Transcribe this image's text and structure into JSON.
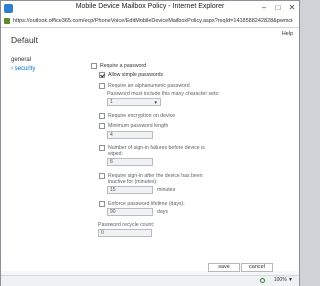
{
  "window": {
    "title": "Mobile Device Mailbox Policy - Internet Explorer",
    "url": "https://outlook.office365.com/ecp/PhoneVoice/EditMobileDeviceMailboxPolicy.aspx?reqId=1418588242828&pwmcid=3&Retu"
  },
  "page": {
    "title": "Default",
    "help": "Help"
  },
  "nav": {
    "items": [
      {
        "label": "general",
        "active": false
      },
      {
        "label": "security",
        "active": true
      }
    ]
  },
  "form": {
    "require_password": {
      "label": "Require a password",
      "checked": false
    },
    "allow_simple": {
      "label": "Allow simple passwords",
      "checked": true
    },
    "require_alnum": {
      "label": "Require an alphanumeric password",
      "checked": false
    },
    "char_sets_label": "Password must include this many character sets:",
    "char_sets_value": "1",
    "require_encryption": {
      "label": "Require encryption on device",
      "checked": false
    },
    "min_length": {
      "label": "Minimum password length",
      "checked": false,
      "value": "4"
    },
    "failures": {
      "label_line1": "Number of sign-in failures before device is",
      "label_line2": "wiped:",
      "checked": false,
      "value": "8"
    },
    "inactive": {
      "label_line1": "Require sign-in after the device has been",
      "label_line2": "inactive for (minutes):",
      "checked": false,
      "value": "15",
      "unit": "minutes"
    },
    "lifetime": {
      "label": "Enforce password lifetime (days):",
      "checked": false,
      "value": "90",
      "unit": "days"
    },
    "recycle": {
      "label": "Password recycle count:",
      "value": "0"
    }
  },
  "footer": {
    "save": "save",
    "cancel": "cancel"
  },
  "status": {
    "zoom": "100%"
  }
}
